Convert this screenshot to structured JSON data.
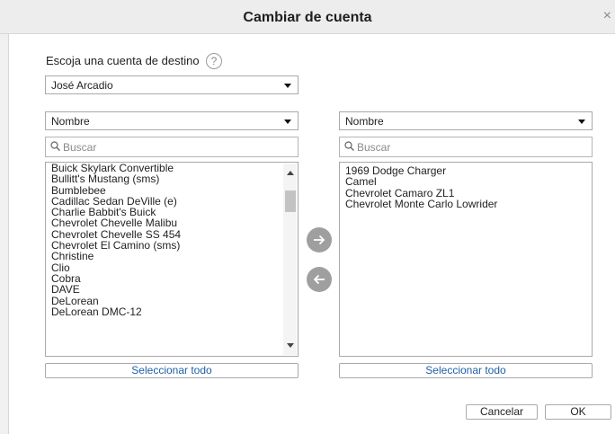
{
  "dialog": {
    "title": "Cambiar de cuenta",
    "close_glyph": "×"
  },
  "destination": {
    "label": "Escoja una cuenta de destino",
    "help_glyph": "?",
    "selected": "José Arcadio"
  },
  "left_panel": {
    "sort_selected": "Nombre",
    "search_placeholder": "Buscar",
    "items": [
      "Buick Skylark Convertible",
      "Bullitt's Mustang (sms)",
      "Bumblebee",
      "Cadillac Sedan DeVille (e)",
      "Charlie Babbit's Buick",
      "Chevrolet Chevelle Malibu",
      "Chevrolet Chevelle SS 454",
      "Chevrolet El Camino (sms)",
      "Christine",
      "Clio",
      "Cobra",
      "DAVE",
      "DeLorean",
      "DeLorean DMC-12"
    ],
    "select_all_label": "Seleccionar todo"
  },
  "right_panel": {
    "sort_selected": "Nombre",
    "search_placeholder": "Buscar",
    "items": [
      "1969 Dodge Charger",
      "Camel",
      "Chevrolet Camaro ZL1",
      "Chevrolet Monte Carlo Lowrider"
    ],
    "select_all_label": "Seleccionar todo"
  },
  "transfer": {
    "move_right_icon": "arrow-right-icon",
    "move_left_icon": "arrow-left-icon"
  },
  "footer": {
    "cancel_label": "Cancelar",
    "ok_label": "OK"
  },
  "colors": {
    "link_blue": "#1f5fa8",
    "arrow_button_gray": "#9f9f9f",
    "titlebar_bg": "#ededed"
  }
}
